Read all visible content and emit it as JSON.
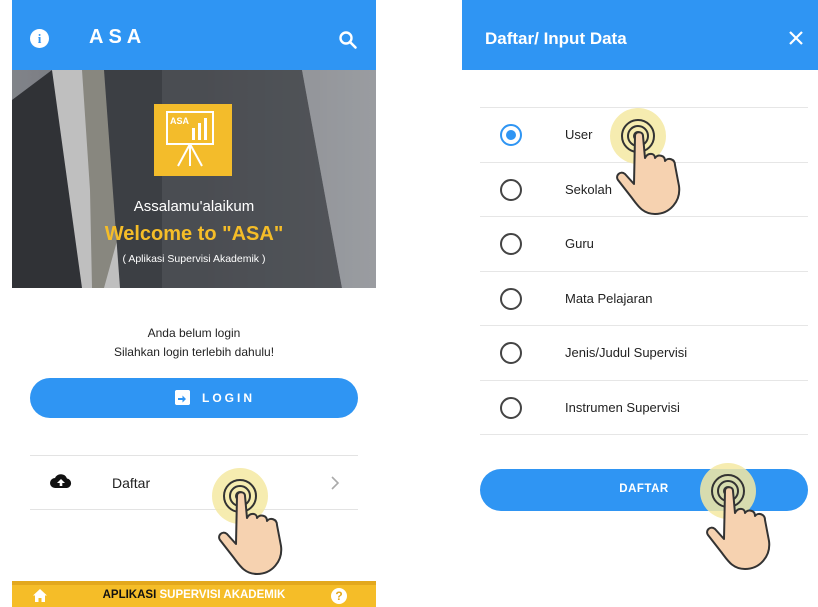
{
  "left_screen": {
    "app_title": "ASA",
    "icons": {
      "info": "info-icon",
      "search": "search-icon"
    },
    "hero": {
      "logo_text": "ASA",
      "greeting": "Assalamu'alaikum",
      "welcome": "Welcome to \"ASA\"",
      "subtitle": "( Aplikasi Supervisi Akademik )"
    },
    "login_message_line1": "Anda belum login",
    "login_message_line2": "Silahkan login terlebih dahulu!",
    "login_button": "LOGIN",
    "daftar_label": "Daftar",
    "bottom_bar": {
      "part1": "APLIKASI",
      "part2": "SUPERVISI AKADEMIK"
    }
  },
  "right_screen": {
    "dialog_title": "Daftar/ Input Data",
    "options": [
      {
        "label": "User",
        "selected": true
      },
      {
        "label": "Sekolah",
        "selected": false
      },
      {
        "label": "Guru",
        "selected": false
      },
      {
        "label": "Mata Pelajaran",
        "selected": false
      },
      {
        "label": "Jenis/Judul Supervisi",
        "selected": false
      },
      {
        "label": "Instrumen Supervisi",
        "selected": false
      }
    ],
    "submit_button": "DAFTAR"
  },
  "colors": {
    "primary": "#2f95f3",
    "accent_yellow": "#f5bd28",
    "text": "#222222"
  }
}
